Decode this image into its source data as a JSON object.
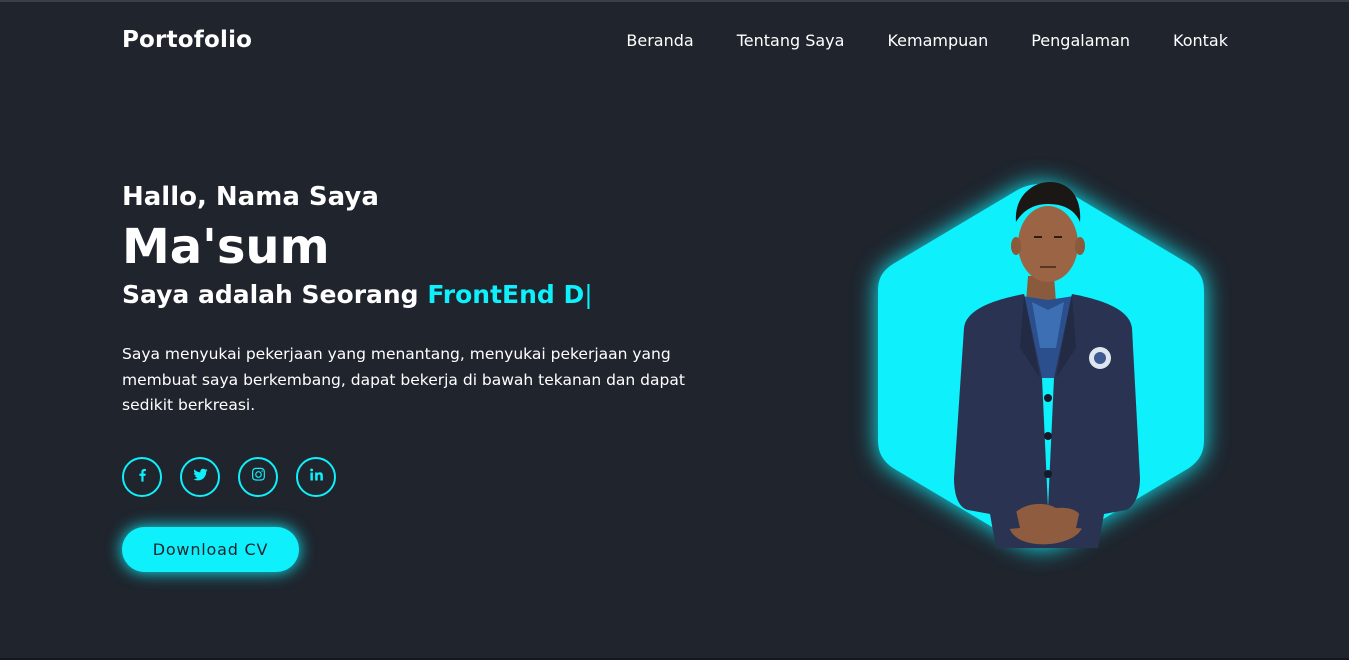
{
  "header": {
    "logo": "Portofolio",
    "nav": [
      "Beranda",
      "Tentang Saya",
      "Kemampuan",
      "Pengalaman",
      "Kontak"
    ]
  },
  "hero": {
    "greeting": "Hallo, Nama Saya",
    "name": "Ma'sum",
    "role_prefix": "Saya adalah Seorang",
    "role_typed": "FrontEnd D",
    "role_cursor": "|",
    "description": "Saya menyukai pekerjaan yang menantang, menyukai pekerjaan yang membuat saya berkembang, dapat bekerja di bawah tekanan dan dapat sedikit berkreasi.",
    "socials": [
      "facebook-icon",
      "twitter-icon",
      "instagram-icon",
      "linkedin-icon"
    ],
    "cta_label": "Download CV"
  },
  "colors": {
    "background": "#1f242d",
    "accent": "#0ef0fb",
    "text": "#ffffff"
  }
}
